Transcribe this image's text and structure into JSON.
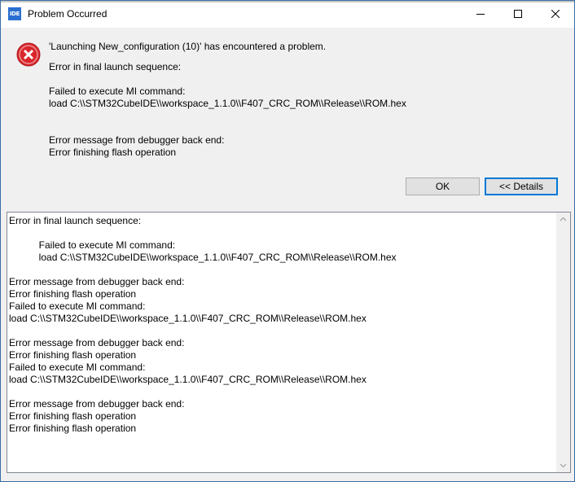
{
  "window": {
    "title": "Problem Occurred",
    "app_icon_text": "IDE"
  },
  "message": {
    "headline": "'Launching New_configuration (10)' has encountered a problem.",
    "lines": [
      "Error in final launch sequence:",
      "",
      "Failed to execute MI command:",
      "load C:\\\\STM32CubeIDE\\\\workspace_1.1.0\\\\F407_CRC_ROM\\\\Release\\\\ROM.hex",
      "",
      "",
      "Error message from debugger back end:",
      "Error finishing flash operation"
    ]
  },
  "buttons": {
    "ok_label": "OK",
    "details_label": "<< Details"
  },
  "details": {
    "text": "Error in final launch sequence:\n\n           Failed to execute MI command:\n           load C:\\\\STM32CubeIDE\\\\workspace_1.1.0\\\\F407_CRC_ROM\\\\Release\\\\ROM.hex\n\nError message from debugger back end:\nError finishing flash operation\nFailed to execute MI command:\nload C:\\\\STM32CubeIDE\\\\workspace_1.1.0\\\\F407_CRC_ROM\\\\Release\\\\ROM.hex\n\nError message from debugger back end:\nError finishing flash operation\nFailed to execute MI command:\nload C:\\\\STM32CubeIDE\\\\workspace_1.1.0\\\\F407_CRC_ROM\\\\Release\\\\ROM.hex\n\nError message from debugger back end:\nError finishing flash operation\nError finishing flash operation"
  },
  "icons": {
    "error": "error-icon",
    "minimize": "minimize-icon",
    "maximize": "maximize-icon",
    "close": "close-icon"
  },
  "colors": {
    "error_red": "#d9262b",
    "accent": "#0078d7"
  }
}
